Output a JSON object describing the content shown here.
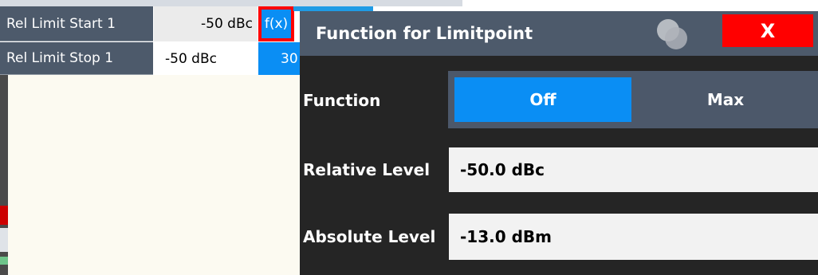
{
  "table": {
    "rows": [
      {
        "label": "Rel Limit Start 1",
        "value": "-50 dBc",
        "func": "f(x)"
      },
      {
        "label": "Rel Limit Stop 1",
        "value": "-50 dBc",
        "partial": "30"
      }
    ]
  },
  "dialog": {
    "title": "Function for Limitpoint",
    "close_label": "X",
    "function": {
      "label": "Function",
      "options": [
        "Off",
        "Max"
      ],
      "selected": "Off"
    },
    "relative_level": {
      "label": "Relative Level",
      "value": "-50.0 dBc"
    },
    "absolute_level": {
      "label": "Absolute Level",
      "value": "-13.0 dBm"
    }
  },
  "colors": {
    "accent": "#0a8ef4",
    "close": "#ff0000",
    "title_bar": "#4d5a6b",
    "dialog_bg": "#252525",
    "field_bg": "#f2f2f2",
    "panel_bg": "#fcfaf1"
  }
}
